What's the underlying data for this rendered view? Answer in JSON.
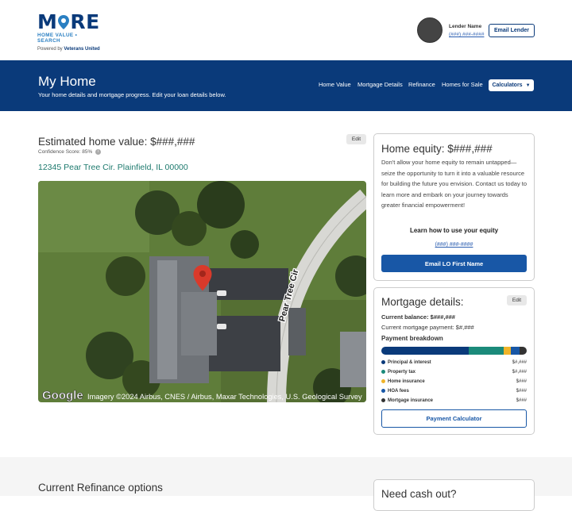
{
  "brand": {
    "logo_word": "MORE",
    "logo_tagline": "HOME VALUE • SEARCH",
    "powered_by": "Powered by",
    "powered_company": "Veterans United"
  },
  "lender": {
    "name": "Lender Name",
    "phone": "(###) ###-####",
    "email_button": "Email Lender"
  },
  "hero": {
    "title": "My Home",
    "subtitle": "Your home details and mortgage progress. Edit your loan details below.",
    "nav": [
      "Home Value",
      "Mortgage Details",
      "Refinance",
      "Homes for Sale"
    ],
    "calculators_label": "Calculators"
  },
  "estimate": {
    "title": "Estimated home value: $###,###",
    "confidence": "Confidence Score: 85%",
    "edit_label": "Edit",
    "address": "12345 Pear Tree Cir. Plainfield, IL 00000"
  },
  "map": {
    "street_label": "Pear Tree Cir",
    "google": "Google",
    "attribution": "Imagery ©2024 Airbus, CNES / Airbus, Maxar Technologies, U.S. Geological Survey"
  },
  "equity": {
    "title": "Home equity: $###,###",
    "body": "Don't allow your home equity to remain untapped—seize the opportunity to turn it into a valuable resource for building the future you envision. Contact us today to learn more and embark on your journey towards greater financial empowerment!",
    "learn": "Learn how to use your equity",
    "phone": "(###) ###-####",
    "email_button": "Email LO First Name"
  },
  "mortgage": {
    "title": "Mortgage details:",
    "edit_label": "Edit",
    "balance": "Current balance: $###,###",
    "payment": "Current mortgage payment: $#,###",
    "breakdown_title": "Payment breakdown",
    "breakdown": [
      {
        "label": "Principal & interest",
        "value": "$#,###",
        "color": "#0a3a7a",
        "share": 0.6
      },
      {
        "label": "Property tax",
        "value": "$#,###",
        "color": "#1b8a7a",
        "share": 0.24
      },
      {
        "label": "Home insurance",
        "value": "$###",
        "color": "#f0b429",
        "share": 0.05
      },
      {
        "label": "HOA fees",
        "value": "$###",
        "color": "#1857a6",
        "share": 0.06
      },
      {
        "label": "Mortgage insurance",
        "value": "$###",
        "color": "#333333",
        "share": 0.05
      }
    ],
    "calc_button": "Payment Calculator"
  },
  "refinance": {
    "title": "Current Refinance options",
    "cash_title": "Need cash out?"
  }
}
